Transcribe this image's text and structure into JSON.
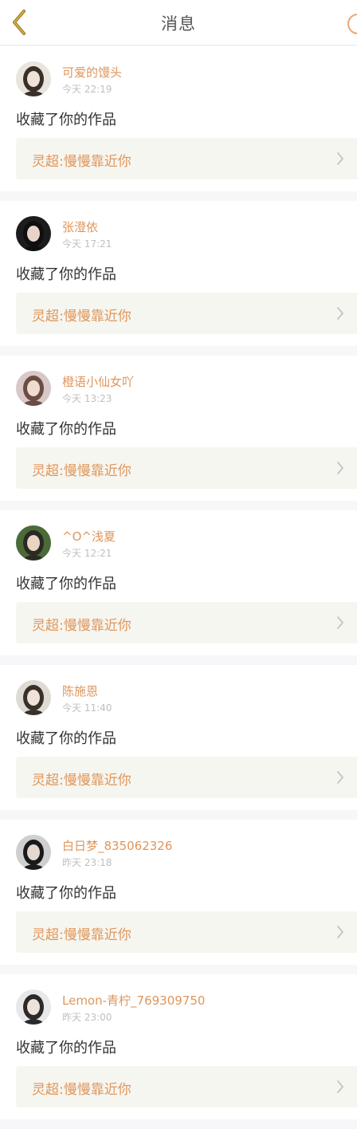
{
  "header": {
    "title": "消息"
  },
  "notifications": [
    {
      "name": "可爱的馒头",
      "time": "今天 22:19",
      "action": "收藏了你的作品",
      "work": "灵超:慢慢靠近你",
      "avatar": {
        "bg": "#e9e4dc",
        "hair": "#3a2f2a",
        "face": "#f1e2d6"
      }
    },
    {
      "name": "张澄依",
      "time": "今天 17:21",
      "action": "收藏了你的作品",
      "work": "灵超:慢慢靠近你",
      "avatar": {
        "bg": "#1c1c1c",
        "hair": "#0f0f0f",
        "face": "#e8d3cb"
      }
    },
    {
      "name": "橙语小仙女吖",
      "time": "今天 13:23",
      "action": "收藏了你的作品",
      "work": "灵超:慢慢靠近你",
      "avatar": {
        "bg": "#d8c8c8",
        "hair": "#6a4e42",
        "face": "#f0dcd0"
      }
    },
    {
      "name": "^O^浅夏",
      "time": "今天 12:21",
      "action": "收藏了你的作品",
      "work": "灵超:慢慢靠近你",
      "avatar": {
        "bg": "#4a6a3a",
        "hair": "#2a2a22",
        "face": "#e8d6c4"
      }
    },
    {
      "name": "陈施恩",
      "time": "今天 11:40",
      "action": "收藏了你的作品",
      "work": "灵超:慢慢靠近你",
      "avatar": {
        "bg": "#dedad4",
        "hair": "#3a302a",
        "face": "#f0e2d6"
      }
    },
    {
      "name": "白日梦_835062326",
      "time": "昨天 23:18",
      "action": "收藏了你的作品",
      "work": "灵超:慢慢靠近你",
      "avatar": {
        "bg": "#cfcfcf",
        "hair": "#1a1a1a",
        "face": "#e4d8d0"
      }
    },
    {
      "name": "Lemon-青柠_769309750",
      "time": "昨天 23:00",
      "action": "收藏了你的作品",
      "work": "灵超:慢慢靠近你",
      "avatar": {
        "bg": "#e8e8e8",
        "hair": "#2a2a2a",
        "face": "#eee2da"
      }
    }
  ],
  "colors": {
    "accent": "#e0955a",
    "back_icon": "#a07a1e",
    "ref_bg": "#f6f6f0"
  }
}
